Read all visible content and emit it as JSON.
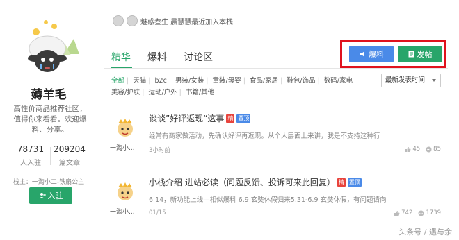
{
  "sidebar": {
    "group_name": "薅羊毛",
    "description": "高性价商品推荐社区，值得你来看看。欢迎爆料、分享。",
    "stats": [
      {
        "value": "78731",
        "label": "人入驻"
      },
      {
        "value": "209204",
        "label": "篇文章"
      }
    ],
    "owner": "栈主：一淘小二-铁扇公主",
    "join_label": "入驻"
  },
  "joined_bar": {
    "text": "魅惑叁生 晨慧慧最近加入本栈"
  },
  "tabs": [
    {
      "label": "精华",
      "active": true
    },
    {
      "label": "爆料",
      "active": false
    },
    {
      "label": "讨论区",
      "active": false
    }
  ],
  "actions": {
    "baoliao_label": "爆料",
    "fatie_label": "发帖"
  },
  "categories": [
    "全部",
    "天猫",
    "b2c",
    "男装/女装",
    "童装/母婴",
    "食品/家居",
    "鞋包/饰品",
    "数码/家电",
    "美容/护肤",
    "运动/户外",
    "书籍/其他"
  ],
  "sort": {
    "selected": "最新发表时间"
  },
  "posts": [
    {
      "author": "一淘小...",
      "title": "谈谈”好评返现“这事",
      "jing": "精",
      "top": "置顶",
      "excerpt": "经常有商家做活动，先确认好评再返现。从个人层面上来讲，我是不支持这种行",
      "time": "3小时前",
      "likes": "45",
      "comments": "85"
    },
    {
      "author": "一淘小...",
      "title": "小栈介绍 进站必读（问题反馈、投诉可来此回复）",
      "jing": "精",
      "top": "置顶",
      "excerpt": "6.14，新功能上线—相似爆料 6.9 玄奘休假归来5.31-6.9 玄奘休假，有问题请向",
      "time": "01/15",
      "likes": "742",
      "comments": "1739"
    }
  ],
  "watermark": "头条号 / 遇与余",
  "colors": {
    "brand_green": "#28a56a",
    "blue": "#4a8ae8",
    "highlight_red": "#e0121d",
    "badge_red": "#e8433c"
  }
}
